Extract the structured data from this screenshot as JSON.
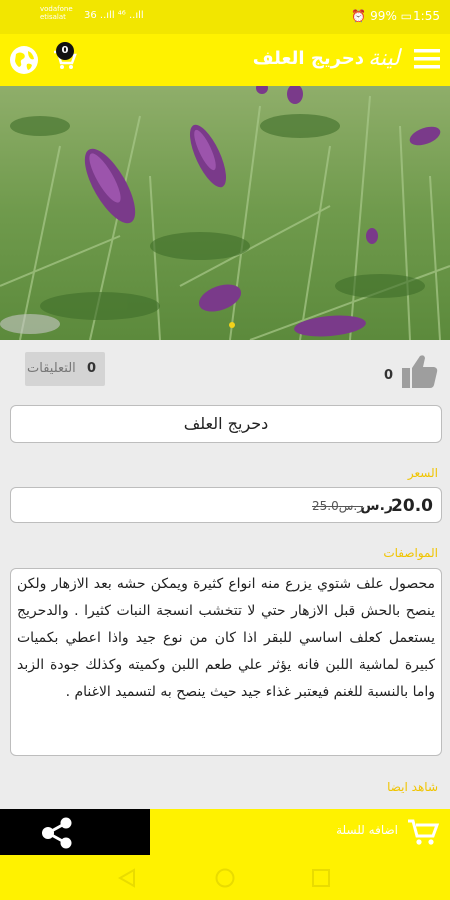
{
  "status_bar": {
    "carrier_line1": "vodafone",
    "carrier_line2": "etisalat",
    "signal": "36 ..ıll ⁴⁶ ..ıll",
    "battery": "99%",
    "time": "1:55"
  },
  "app_bar": {
    "cart_count": "0",
    "logo_text": "لينة",
    "title": "دحريج العلف"
  },
  "social": {
    "comments_count": "0",
    "comments_label": "التعليقات",
    "likes_count": "0"
  },
  "product": {
    "name": "دحريج العلف",
    "price_label": "السعر",
    "price_current": "20.0",
    "price_unit": "ر.س",
    "price_old": "25.0ر.س",
    "specs_label": "المواصفات",
    "description": "محصول علف شتوي يزرع منه انواع كثيرة ويمكن حشه بعد الازهار ولكن ينصح بالحش قبل الازهار حتي لا تتخشب انسجة النبات كثيرا . والدحريج يستعمل كعلف اساسي للبقر اذا كان من نوع جيد واذا اعطي بكميات كبيرة لماشية اللبن فانه يؤثر علي طعم اللبن وكميته وكذلك جودة الزبد واما بالنسبة للغنم فيعتبر غذاء جيد حيث ينصح به لتسميد الاغنام .",
    "see_also_label": "شاهد ايضا"
  },
  "bottom_bar": {
    "add_to_cart_label": "اضافه للسلة"
  },
  "colors": {
    "brand_yellow": "#fff200",
    "label_yellow": "#f0c400"
  }
}
